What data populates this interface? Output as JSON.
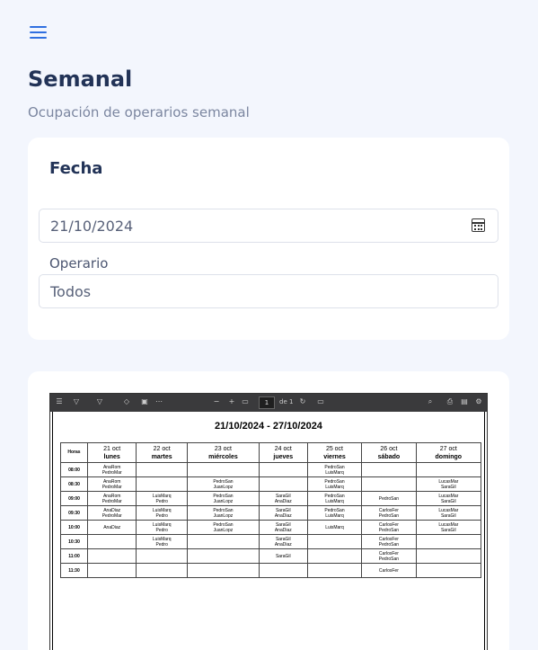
{
  "header": {
    "title": "Semanal",
    "subtitle": "Ocupación de operarios semanal"
  },
  "filters": {
    "title": "Fecha",
    "date_value": "21/10/2024",
    "operario_label": "Operario",
    "operario_value": "Todos"
  },
  "pdf": {
    "page_number": "1",
    "page_of": "de 1",
    "title": "21/10/2024 - 27/10/2024",
    "hours_header": "Horas",
    "days": [
      {
        "date": "21 oct",
        "name": "lunes"
      },
      {
        "date": "22 oct",
        "name": "martes"
      },
      {
        "date": "23 oct",
        "name": "miércoles"
      },
      {
        "date": "24 oct",
        "name": "jueves"
      },
      {
        "date": "25 oct",
        "name": "viernes"
      },
      {
        "date": "26 oct",
        "name": "sábado"
      },
      {
        "date": "27 oct",
        "name": "domingo"
      }
    ],
    "rows": [
      {
        "hour": "08:00",
        "cells": [
          "AnaRom\nPedroMar",
          "",
          "",
          "",
          "PedroSan\nLuisMarq",
          "",
          ""
        ]
      },
      {
        "hour": "08:30",
        "cells": [
          "AnaRom\nPedroMar",
          "",
          "PedroSan\nJuanLopz",
          "",
          "PedroSan\nLuisMarq",
          "",
          "LucasMar\nSaraGil"
        ]
      },
      {
        "hour": "09:00",
        "cells": [
          "AnaRom\nPedroMar",
          "LuisMarq\nPedro",
          "PedroSan\nJuanLopz",
          "SaraGil\nAnaDiaz",
          "PedroSan\nLuisMarq",
          "PedroSan",
          "LucasMar\nSaraGil"
        ]
      },
      {
        "hour": "09:30",
        "cells": [
          "AnaDiaz\nPedroMar",
          "LuisMarq\nPedro",
          "PedroSan\nJuanLopz",
          "SaraGil\nAnaDiaz",
          "PedroSan\nLuisMarq",
          "CarlosFer\nPedroSan",
          "LucasMar\nSaraGil"
        ]
      },
      {
        "hour": "10:00",
        "cells": [
          "AnaDiaz",
          "LuisMarq\nPedro",
          "PedroSan\nJuanLopz",
          "SaraGil\nAnaDiaz",
          "LuisMarq",
          "CarlosFer\nPedroSan",
          "LucasMar\nSaraGil"
        ]
      },
      {
        "hour": "10:30",
        "cells": [
          "",
          "LuisMarq\nPedro",
          "",
          "SaraGil\nAnaDiaz",
          "",
          "CarlosFer\nPedroSan",
          ""
        ]
      },
      {
        "hour": "11:00",
        "cells": [
          "",
          "",
          "",
          "SaraGil",
          "",
          "CarlosFer\nPedroSan",
          ""
        ]
      },
      {
        "hour": "11:30",
        "cells": [
          "",
          "",
          "",
          "",
          "",
          "CarlosFer",
          ""
        ]
      }
    ]
  }
}
